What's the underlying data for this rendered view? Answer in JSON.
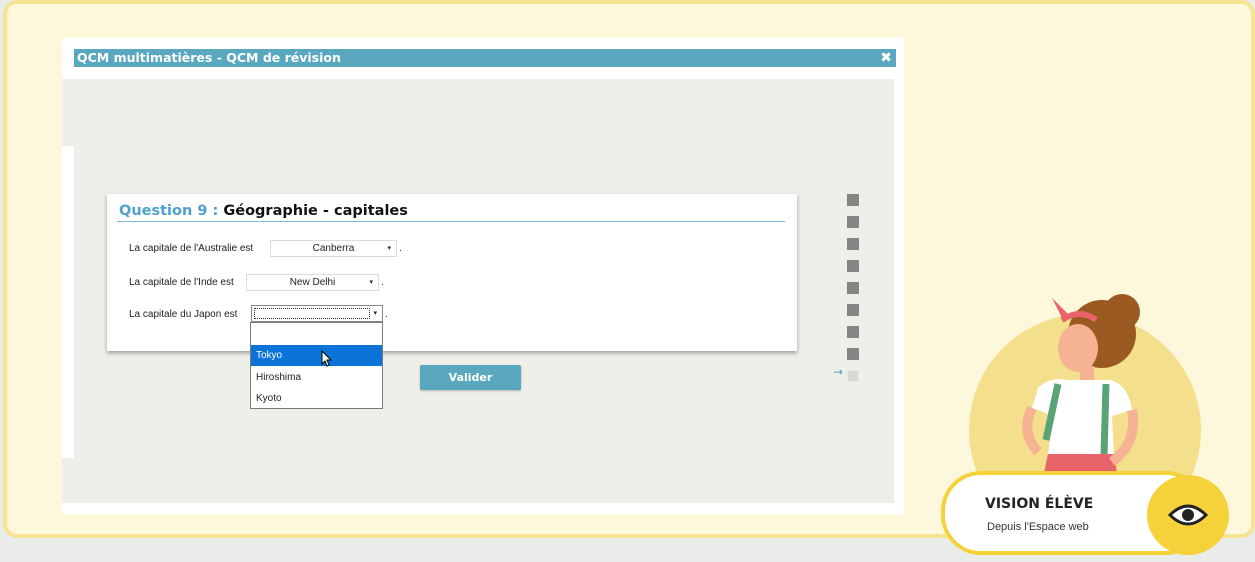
{
  "window": {
    "title": "QCM multimatières - QCM de révision",
    "close_icon": "close-icon"
  },
  "question": {
    "number_label": "Question 9 :",
    "subject": "Géographie - capitales",
    "lines": [
      {
        "prefix": "La capitale de l'Australie est",
        "value": "Canberra",
        "suffix": "."
      },
      {
        "prefix": "La capitale de l'Inde est",
        "value": "New Delhi",
        "suffix": "."
      },
      {
        "prefix": "La capitale du Japon est",
        "value": "",
        "suffix": "."
      }
    ],
    "dropdown_arrow": "▾",
    "dropdown_options": [
      "",
      "Tokyo",
      "Hiroshima",
      "Kyoto"
    ],
    "dropdown_highlighted": "Tokyo"
  },
  "actions": {
    "validate_label": "Valider"
  },
  "progress": {
    "total": 9,
    "current": 9,
    "arrow": "→"
  },
  "badge": {
    "title": "VISION ÉLÈVE",
    "subtitle": "Depuis l'Espace web"
  },
  "colors": {
    "accent": "#5aa7c0",
    "frame_border": "#f7e392",
    "badge_yellow": "#f5d13a",
    "selection": "#0a74d8"
  }
}
